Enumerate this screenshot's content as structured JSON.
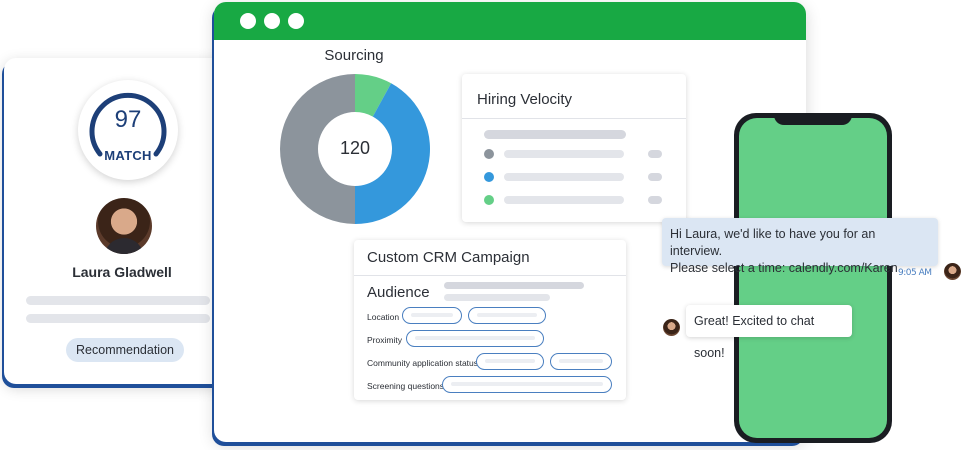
{
  "candidate_card": {
    "match_score": "97",
    "match_label": "MATCH",
    "match_fraction": 0.97,
    "name": "Laura Gladwell",
    "recommendation_label": "Recommendation"
  },
  "sourcing": {
    "title": "Sourcing",
    "total": "120",
    "segments": [
      {
        "color": "#64cf87",
        "fraction": 0.08
      },
      {
        "color": "#3498dc",
        "fraction": 0.42
      },
      {
        "color": "#8c949c",
        "fraction": 0.5
      }
    ]
  },
  "hiring_velocity": {
    "title": "Hiring Velocity",
    "legend_colors": [
      "#8c949c",
      "#3498dc",
      "#64cf87"
    ]
  },
  "crm_campaign": {
    "title": "Custom CRM Campaign",
    "section": "Audience",
    "fields": [
      {
        "label": "Location"
      },
      {
        "label": "Proximity"
      },
      {
        "label": "Community application status"
      },
      {
        "label": "Screening questions"
      }
    ]
  },
  "chat": {
    "outgoing_line1": "Hi Laura, we'd like to have you for an interview.",
    "outgoing_line2": "Please select a time: calendly.com/Karen",
    "timestamp": "9:05 AM",
    "incoming": "Great! Excited to chat soon!"
  },
  "colors": {
    "brand_green": "#18a944",
    "navy": "#1d3f78",
    "accent_blue": "#4a7fc0"
  }
}
